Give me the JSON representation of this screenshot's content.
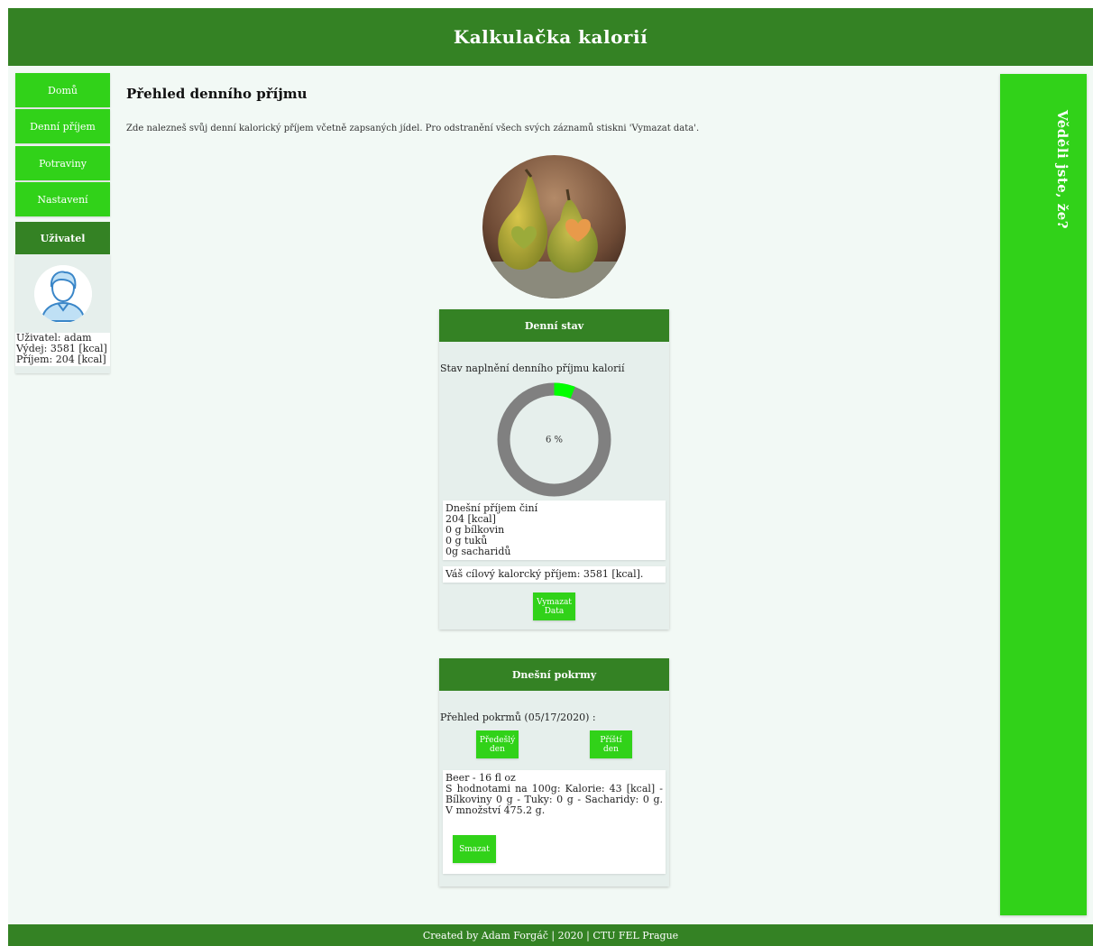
{
  "header": {
    "title": "Kalkulačka kalorií"
  },
  "nav": {
    "items": [
      {
        "label": "Domů"
      },
      {
        "label": "Denní příjem"
      },
      {
        "label": "Potraviny"
      },
      {
        "label": "Nastavení"
      }
    ]
  },
  "user_panel": {
    "title": "Uživatel",
    "username_line": "Uživatel: adam",
    "expense_line": "Výdej: 3581 [kcal]",
    "intake_line": "Příjem: 204 [kcal]",
    "avatar_icon": "user-avatar-icon"
  },
  "main": {
    "title": "Přehled denního příjmu",
    "description": "Zde nalezneš svůj denní kalorický příjem včetně zapsaných jídel. Pro odstranění všech svých záznamů stiskni 'Vymazat data'.",
    "image": "pears-photo"
  },
  "daily_status": {
    "title": "Denní stav",
    "label": "Stav naplnění denního příjmu kalorií",
    "progress_percent": 6,
    "progress_text": "6 %",
    "intake_lines": [
      "Dnešní příjem činí",
      "204 [kcal]",
      "0 g bílkovin",
      "0 g tuků",
      "0g sacharidů"
    ],
    "target_text": "Váš cílový kalorcký příjem: 3581 [kcal].",
    "clear_button": [
      "Vymazat",
      "Data"
    ]
  },
  "meals": {
    "title": "Dnešní pokrmy",
    "overview_label": "Přehled pokrmů (05/17/2020) :",
    "prev_button": [
      "Předešlý",
      "den"
    ],
    "next_button": [
      "Příští",
      "den"
    ],
    "items": [
      {
        "name": "Beer - 16 fl oz",
        "details": "S hodnotami na 100g: Kalorie: 43 [kcal] - Bílkoviny 0 g - Tuky: 0 g - Sacharidy: 0 g. V množství 475.2 g.",
        "delete_label": "Smazat"
      }
    ]
  },
  "aside": {
    "title": "Věděli jste, že?"
  },
  "footer": {
    "text": "Created by Adam Forgáč | 2020 | CTU FEL Prague"
  },
  "colors": {
    "dark_green": "#348224",
    "bright_green": "#31d219",
    "panel_bg": "#e6efec",
    "page_bg": "#f2f9f5",
    "progress_track": "#808080",
    "progress_fill": "#00ff00"
  }
}
